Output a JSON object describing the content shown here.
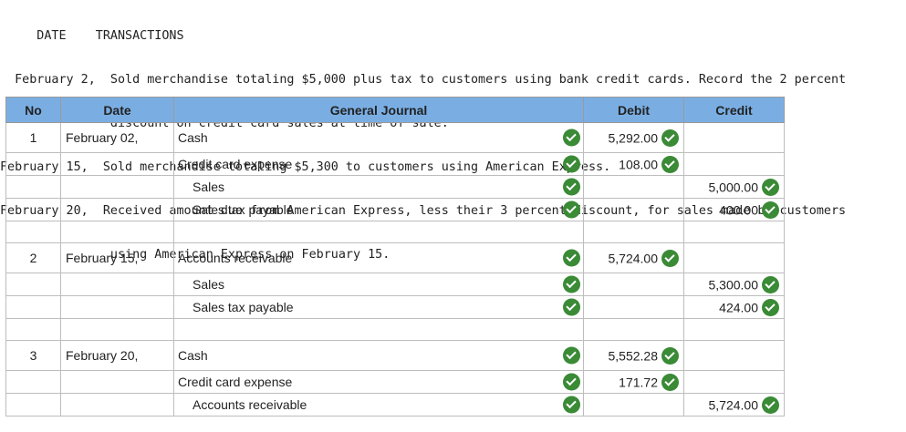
{
  "problem": {
    "lines": [
      "     DATE    TRANSACTIONS",
      "  February 2,  Sold merchandise totaling $5,000 plus tax to customers using bank credit cards. Record the 2 percent",
      "               discount on credit card sales at time of sale.",
      "February 15,  Sold merchandise totaling $5,300 to customers using American Express.",
      "February 20,  Received amount due from American Express, less their 3 percent discount, for sales made by customers",
      "               using American Express on February 15."
    ]
  },
  "journal": {
    "headers": {
      "no": "No",
      "date": "Date",
      "general_journal": "General Journal",
      "debit": "Debit",
      "credit": "Credit"
    },
    "rows": [
      {
        "no": "1",
        "date": "February 02,",
        "account": "Cash",
        "debit": "5,292.00",
        "credit": ""
      },
      {
        "no": "",
        "date": "",
        "account": "Credit card expense",
        "debit": "108.00",
        "credit": ""
      },
      {
        "no": "",
        "date": "",
        "account": "Sales",
        "debit": "",
        "credit": "5,000.00"
      },
      {
        "no": "",
        "date": "",
        "account": "Sales tax payable",
        "debit": "",
        "credit": "400.00"
      },
      {
        "no": "",
        "date": "",
        "account": "",
        "debit": "",
        "credit": ""
      },
      {
        "no": "2",
        "date": "February 15,",
        "account": "Accounts receivable",
        "debit": "5,724.00",
        "credit": ""
      },
      {
        "no": "",
        "date": "",
        "account": "Sales",
        "debit": "",
        "credit": "5,300.00"
      },
      {
        "no": "",
        "date": "",
        "account": "Sales tax payable",
        "debit": "",
        "credit": "424.00"
      },
      {
        "no": "",
        "date": "",
        "account": "",
        "debit": "",
        "credit": ""
      },
      {
        "no": "3",
        "date": "February 20,",
        "account": "Cash",
        "debit": "5,552.28",
        "credit": ""
      },
      {
        "no": "",
        "date": "",
        "account": "Credit card expense",
        "debit": "171.72",
        "credit": ""
      },
      {
        "no": "",
        "date": "",
        "account": "Accounts receivable",
        "debit": "",
        "credit": "5,724.00"
      }
    ]
  },
  "icons": {
    "correct": "check-circle-icon"
  },
  "colors": {
    "header_bg": "#7aaee3",
    "check_green": "#3a8a36"
  }
}
